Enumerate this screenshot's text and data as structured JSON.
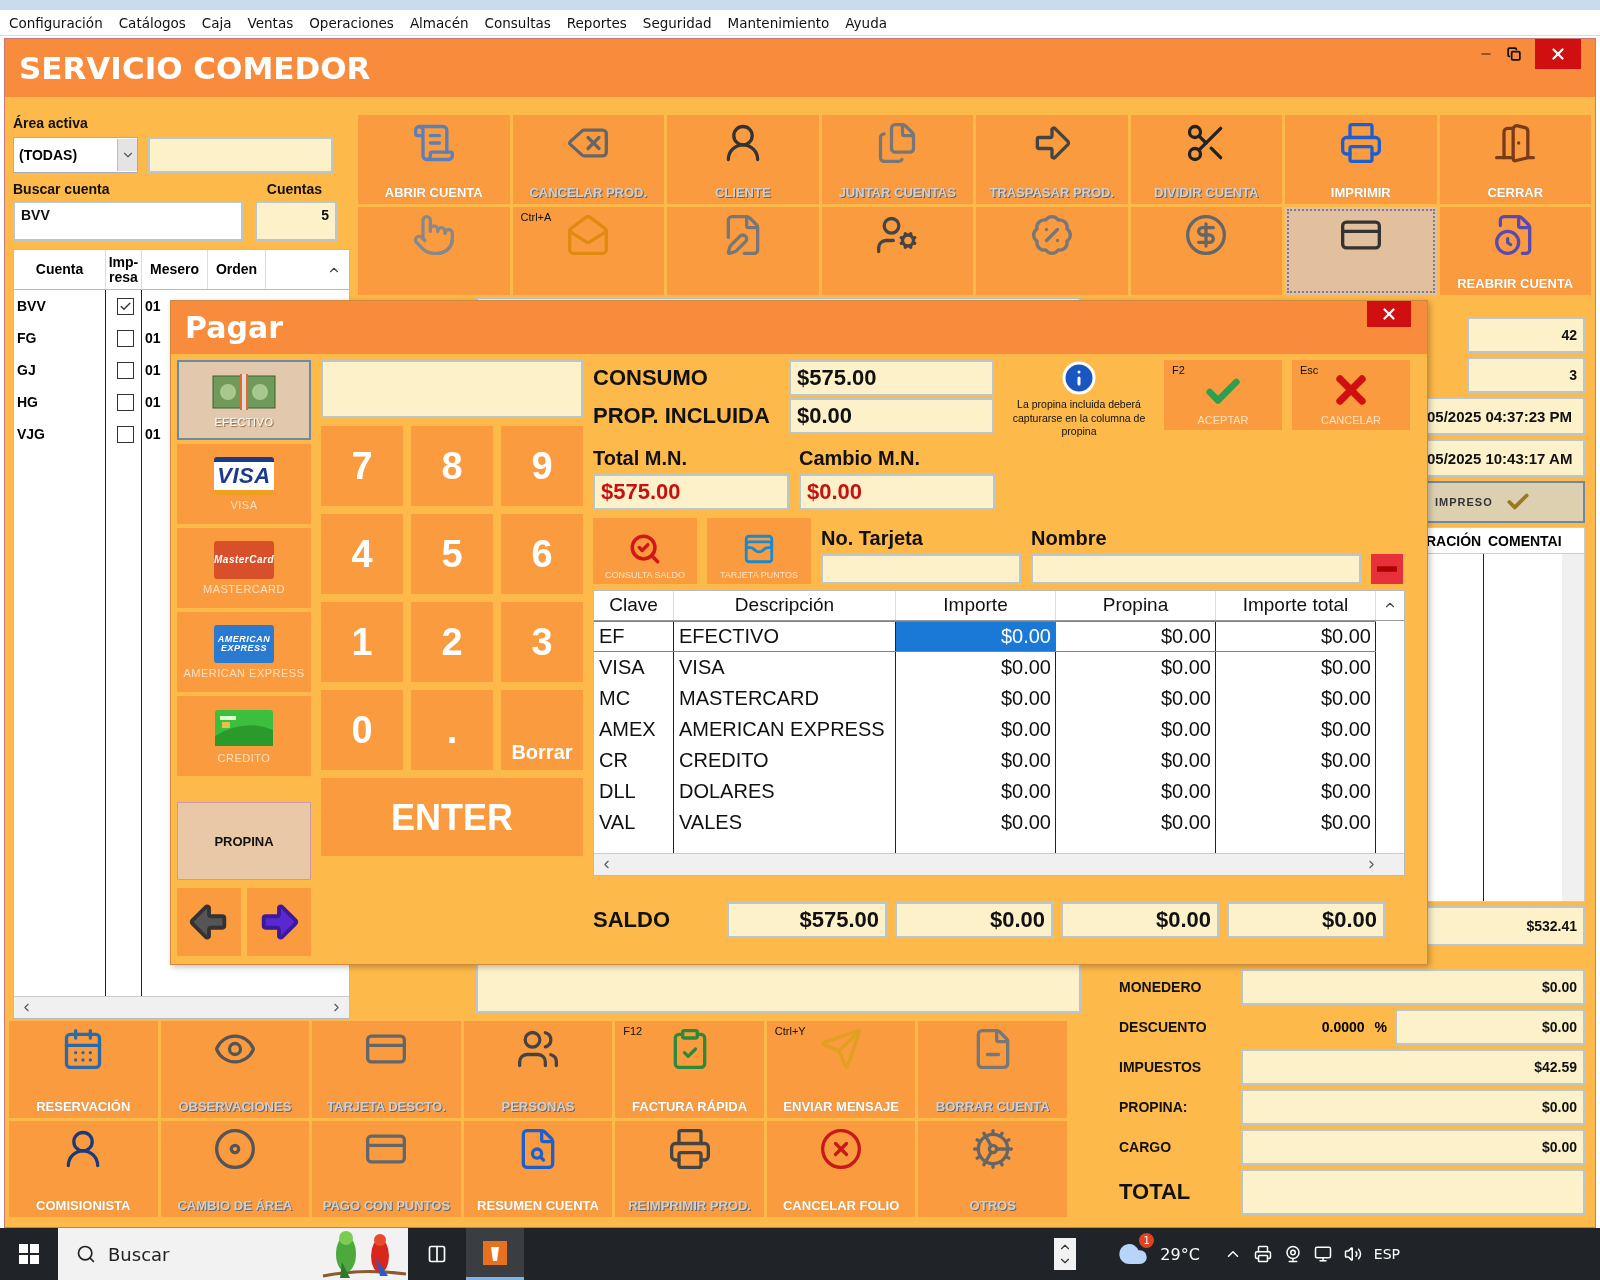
{
  "menu": [
    "Configuración",
    "Catálogos",
    "Caja",
    "Ventas",
    "Operaciones",
    "Almacén",
    "Consultas",
    "Reportes",
    "Seguridad",
    "Mantenimiento",
    "Ayuda"
  ],
  "window": {
    "title": "SERVICIO COMEDOR"
  },
  "filters": {
    "area_label": "Área activa",
    "area_value": "(TODAS)",
    "search_label": "Buscar cuenta",
    "search_value": "BVV",
    "count_label": "Cuentas",
    "count_value": "5"
  },
  "accounts": {
    "columns": [
      "Cuenta",
      "Imp-resa",
      "Mesero",
      "Orden"
    ],
    "rows": [
      {
        "cuenta": "BVV",
        "impresa": true,
        "mesero": "01"
      },
      {
        "cuenta": "FG",
        "impresa": false,
        "mesero": "01"
      },
      {
        "cuenta": "GJ",
        "impresa": false,
        "mesero": "01"
      },
      {
        "cuenta": "HG",
        "impresa": false,
        "mesero": "01"
      },
      {
        "cuenta": "VJG",
        "impresa": false,
        "mesero": "01"
      }
    ]
  },
  "top_buttons": [
    {
      "label": "ABRIR CUENTA",
      "disabled": false,
      "selected": false
    },
    {
      "label": "CANCELAR PROD.",
      "disabled": true,
      "selected": false
    },
    {
      "label": "CLIENTE",
      "disabled": true,
      "selected": false
    },
    {
      "label": "JUNTAR CUENTAS",
      "disabled": true,
      "selected": false
    },
    {
      "label": "TRASPASAR PROD.",
      "disabled": true,
      "selected": false
    },
    {
      "label": "DIVIDIR CUENTA",
      "disabled": true,
      "selected": false
    },
    {
      "label": "IMPRIMIR",
      "disabled": false,
      "selected": false
    },
    {
      "label": "CERRAR",
      "disabled": false,
      "selected": false
    },
    {
      "selected": false
    },
    {
      "shortcut": "Ctrl+A",
      "selected": false
    },
    {
      "selected": false
    },
    {
      "selected": false
    },
    {
      "selected": false
    },
    {
      "selected": false
    },
    {
      "selected": true
    },
    {
      "label": "REABRIR CUENTA",
      "disabled": false,
      "selected": false
    }
  ],
  "right_panel": {
    "fields": [
      "42",
      "3",
      "05/2025 04:37:23 PM",
      "05/2025 10:43:17 AM"
    ],
    "printed_label": "IMPRESO",
    "columns": [
      "RACIÓN",
      "COMENTAI"
    ],
    "subtotal": "$532.41"
  },
  "totals": [
    {
      "kind": "plain",
      "label": "MONEDERO",
      "value": "$0.00"
    },
    {
      "kind": "percent",
      "label": "DESCUENTO",
      "percent": "0.0000",
      "unit": "%",
      "value": "$0.00"
    },
    {
      "kind": "plain",
      "label": "IMPUESTOS",
      "value": "$42.59"
    },
    {
      "kind": "plain",
      "label": "PROPINA:",
      "value": "$0.00"
    },
    {
      "kind": "plain",
      "label": "CARGO",
      "value": "$0.00"
    },
    {
      "kind": "grand",
      "label": "TOTAL"
    }
  ],
  "bottom_buttons": [
    {
      "label": "RESERVACIÓN",
      "disabled": false
    },
    {
      "label": "OBSERVACIONES",
      "disabled": true
    },
    {
      "label": "TARJETA DESCTO.",
      "disabled": true
    },
    {
      "label": "PERSONAS",
      "disabled": true
    },
    {
      "label": "FACTURA RÁPIDA",
      "shortcut": "F12",
      "disabled": false
    },
    {
      "label": "ENVIAR MENSAJE",
      "shortcut": "Ctrl+Y",
      "disabled": false
    },
    {
      "label": "BORRAR CUENTA",
      "disabled": true
    },
    {
      "label": "COMISIONISTA",
      "disabled": false
    },
    {
      "label": "CAMBIO DE ÁREA",
      "disabled": true
    },
    {
      "label": "PAGO CON PUNTOS",
      "disabled": true
    },
    {
      "label": "RESUMEN CUENTA",
      "disabled": false
    },
    {
      "label": "REIMPRIMIR PROD.",
      "disabled": true
    },
    {
      "label": "CANCELAR FOLIO",
      "disabled": false
    },
    {
      "label": "OTROS",
      "disabled": true
    }
  ],
  "payment": {
    "title": "Pagar",
    "methods": [
      {
        "label": "EFECTIVO",
        "selected": true
      },
      {
        "label": "VISA",
        "logo": "VISA",
        "selected": false
      },
      {
        "label": "MASTERCARD",
        "logo": "MasterCard",
        "selected": false
      },
      {
        "label": "AMERICAN EXPRESS",
        "logo": "AMERICAN EXPRESS",
        "selected": false
      },
      {
        "label": "CREDITO",
        "selected": false
      }
    ],
    "tip_button": "PROPINA",
    "keys": [
      {
        "kind": "digit",
        "label": "7"
      },
      {
        "kind": "digit",
        "label": "8"
      },
      {
        "kind": "digit",
        "label": "9"
      },
      {
        "kind": "digit",
        "label": "4"
      },
      {
        "kind": "digit",
        "label": "5"
      },
      {
        "kind": "digit",
        "label": "6"
      },
      {
        "kind": "digit",
        "label": "1"
      },
      {
        "kind": "digit",
        "label": "2"
      },
      {
        "kind": "digit",
        "label": "3"
      },
      {
        "kind": "digit",
        "label": "0"
      },
      {
        "kind": "digit",
        "label": "."
      },
      {
        "kind": "text",
        "label": "Borrar"
      }
    ],
    "enter": "ENTER",
    "consumo": {
      "label": "CONSUMO",
      "value": "$575.00"
    },
    "prop": {
      "label": "PROP. INCLUIDA",
      "value": "$0.00"
    },
    "note": "La propina incluida deberá capturarse en la columna de propina",
    "accept": {
      "shortcut": "F2",
      "label": "ACEPTAR"
    },
    "cancel": {
      "shortcut": "Esc",
      "label": "CANCELAR"
    },
    "total": {
      "label": "Total M.N.",
      "value": "$575.00"
    },
    "change": {
      "label": "Cambio M.N.",
      "value": "$0.00"
    },
    "card_buttons": [
      "CONSULTA SALDO",
      "TARJETA PUNTOS"
    ],
    "card_label": "No. Tarjeta",
    "name_label": "Nombre",
    "table": {
      "columns": [
        "Clave",
        "Descripción",
        "Importe",
        "Propina",
        "Importe total"
      ],
      "rows": [
        {
          "clave": "EF",
          "descripcion": "EFECTIVO",
          "importe": "$0.00",
          "propina": "$0.00",
          "total": "$0.00",
          "selected": true
        },
        {
          "clave": "VISA",
          "descripcion": "VISA",
          "importe": "$0.00",
          "propina": "$0.00",
          "total": "$0.00",
          "selected": false
        },
        {
          "clave": "MC",
          "descripcion": "MASTERCARD",
          "importe": "$0.00",
          "propina": "$0.00",
          "total": "$0.00",
          "selected": false
        },
        {
          "clave": "AMEX",
          "descripcion": "AMERICAN EXPRESS",
          "importe": "$0.00",
          "propina": "$0.00",
          "total": "$0.00",
          "selected": false
        },
        {
          "clave": "CR",
          "descripcion": "CREDITO",
          "importe": "$0.00",
          "propina": "$0.00",
          "total": "$0.00",
          "selected": false
        },
        {
          "clave": "DLL",
          "descripcion": "DOLARES",
          "importe": "$0.00",
          "propina": "$0.00",
          "total": "$0.00",
          "selected": false
        },
        {
          "clave": "VAL",
          "descripcion": "VALES",
          "importe": "$0.00",
          "propina": "$0.00",
          "total": "$0.00",
          "selected": false
        }
      ]
    },
    "saldo": {
      "label": "SALDO",
      "values": [
        "$575.00",
        "$0.00",
        "$0.00",
        "$0.00"
      ]
    }
  },
  "taskbar": {
    "search_placeholder": "Buscar",
    "temperature": "29°C",
    "badge": "1",
    "language": "ESP"
  }
}
